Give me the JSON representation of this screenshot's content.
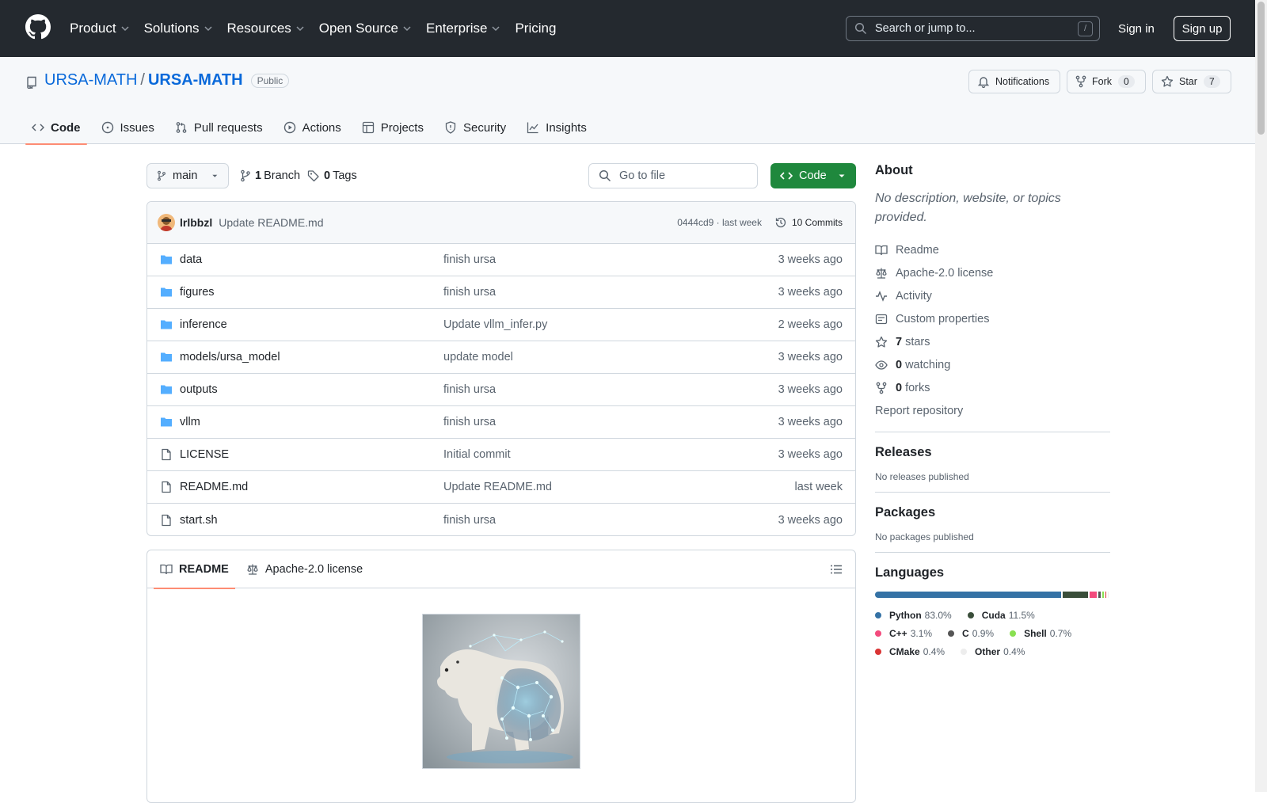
{
  "header": {
    "nav": [
      "Product",
      "Solutions",
      "Resources",
      "Open Source",
      "Enterprise",
      "Pricing"
    ],
    "search_placeholder": "Search or jump to...",
    "search_shortcut": "/",
    "sign_in": "Sign in",
    "sign_up": "Sign up"
  },
  "repo": {
    "owner": "URSA-MATH",
    "separator": "/",
    "name": "URSA-MATH",
    "visibility": "Public",
    "notifications_label": "Notifications",
    "fork_label": "Fork",
    "fork_count": "0",
    "star_label": "Star",
    "star_count": "7"
  },
  "tabs": [
    "Code",
    "Issues",
    "Pull requests",
    "Actions",
    "Projects",
    "Security",
    "Insights"
  ],
  "toolbar": {
    "branch": "main",
    "branch_count": "1",
    "branch_label": "Branch",
    "tag_count": "0",
    "tag_label": "Tags",
    "goto_placeholder": "Go to file",
    "code_button": "Code"
  },
  "commit": {
    "author": "lrlbbzl",
    "message": "Update README.md",
    "hash_time": "0444cd9 · last week",
    "commits_label": "10 Commits"
  },
  "files": [
    {
      "type": "dir",
      "name": "data",
      "message": "finish ursa",
      "date": "3 weeks ago"
    },
    {
      "type": "dir",
      "name": "figures",
      "message": "finish ursa",
      "date": "3 weeks ago"
    },
    {
      "type": "dir",
      "name": "inference",
      "message": "Update vllm_infer.py",
      "date": "2 weeks ago"
    },
    {
      "type": "dir",
      "name": "models/ursa_model",
      "message": "update model",
      "date": "3 weeks ago"
    },
    {
      "type": "dir",
      "name": "outputs",
      "message": "finish ursa",
      "date": "3 weeks ago"
    },
    {
      "type": "dir",
      "name": "vllm",
      "message": "finish ursa",
      "date": "3 weeks ago"
    },
    {
      "type": "file",
      "name": "LICENSE",
      "message": "Initial commit",
      "date": "3 weeks ago"
    },
    {
      "type": "file",
      "name": "README.md",
      "message": "Update README.md",
      "date": "last week"
    },
    {
      "type": "file",
      "name": "start.sh",
      "message": "finish ursa",
      "date": "3 weeks ago"
    }
  ],
  "readme": {
    "tab_readme": "README",
    "tab_license": "Apache-2.0 license"
  },
  "sidebar": {
    "about_title": "About",
    "about_desc": "No description, website, or topics provided.",
    "items": [
      {
        "icon": "book-icon",
        "bold": "",
        "text": "Readme"
      },
      {
        "icon": "scale-icon",
        "bold": "",
        "text": "Apache-2.0 license"
      },
      {
        "icon": "pulse-icon",
        "bold": "",
        "text": "Activity"
      },
      {
        "icon": "note-icon",
        "bold": "",
        "text": "Custom properties"
      },
      {
        "icon": "star-icon",
        "bold": "7",
        "text": "stars"
      },
      {
        "icon": "eye-icon",
        "bold": "0",
        "text": "watching"
      },
      {
        "icon": "fork-icon",
        "bold": "0",
        "text": "forks"
      }
    ],
    "report": "Report repository",
    "releases_title": "Releases",
    "releases_text": "No releases published",
    "packages_title": "Packages",
    "packages_text": "No packages published",
    "languages_title": "Languages",
    "languages": [
      {
        "name": "Python",
        "percent": "83.0%",
        "value": 83.0,
        "color": "#3572A5"
      },
      {
        "name": "Cuda",
        "percent": "11.5%",
        "value": 11.5,
        "color": "#3A4E3A"
      },
      {
        "name": "C++",
        "percent": "3.1%",
        "value": 3.1,
        "color": "#f34b7d"
      },
      {
        "name": "C",
        "percent": "0.9%",
        "value": 0.9,
        "color": "#555555"
      },
      {
        "name": "Shell",
        "percent": "0.7%",
        "value": 0.7,
        "color": "#89e051"
      },
      {
        "name": "CMake",
        "percent": "0.4%",
        "value": 0.4,
        "color": "#DA3434"
      },
      {
        "name": "Other",
        "percent": "0.4%",
        "value": 0.4,
        "color": "#ededed"
      }
    ]
  },
  "colors": {
    "header_bg": "#24292f",
    "link": "#0969da",
    "code_button": "#1f883d",
    "tab_underline": "#fd8c73",
    "folder": "#54aeff"
  }
}
